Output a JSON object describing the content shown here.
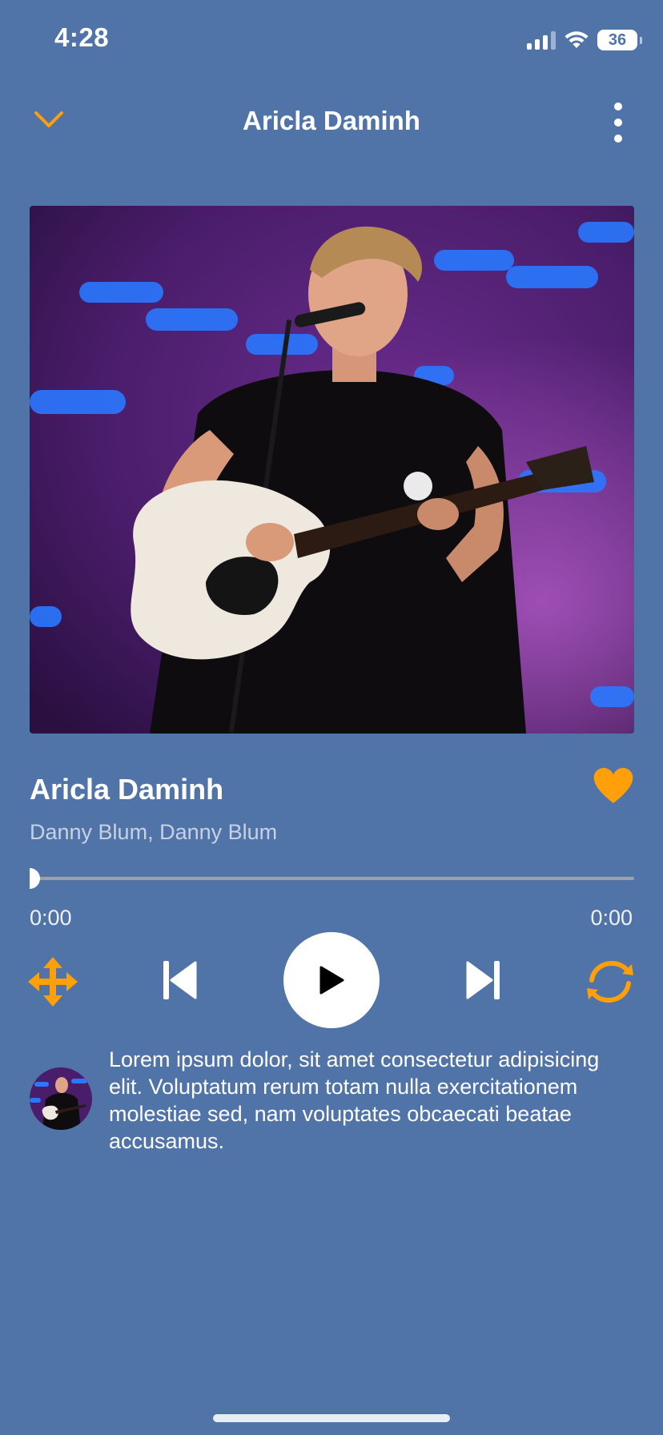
{
  "status_bar": {
    "time": "4:28",
    "battery": "36"
  },
  "header": {
    "title": "Aricla Daminh",
    "left_icon": "chevron-down-icon",
    "right_icon": "more-vertical-icon"
  },
  "track": {
    "title": "Aricla Daminh",
    "artists": "Danny Blum, Danny Blum",
    "liked": true
  },
  "progress": {
    "current": "0:00",
    "duration": "0:00",
    "fraction": 0
  },
  "controls": {
    "shuffle_icon": "move-arrows-icon",
    "prev_icon": "skip-previous-icon",
    "play_icon": "play-icon",
    "next_icon": "skip-next-icon",
    "repeat_icon": "repeat-icon"
  },
  "description": {
    "text": "Lorem ipsum dolor, sit amet consectetur adipisicing elit. Voluptatum rerum totam nulla exercitationem molestiae sed, nam voluptates obcaecati beatae accusamus."
  },
  "colors": {
    "background": "#5073a8",
    "accent": "#ff9f0a",
    "text": "#ffffff"
  }
}
